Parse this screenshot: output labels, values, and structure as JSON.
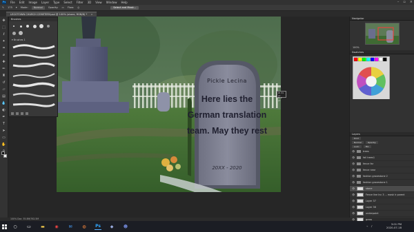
{
  "menubar": {
    "items": [
      "File",
      "Edit",
      "Image",
      "Layer",
      "Type",
      "Select",
      "Filter",
      "3D",
      "View",
      "Window",
      "Help"
    ]
  },
  "options": {
    "brush_size": "175",
    "mode_label": "Mode:",
    "mode_value": "Normal",
    "opacity_label": "Opacity:",
    "flow_label": "Flow:",
    "select_mask": "Select and Mask..."
  },
  "document": {
    "tab_title": "LEGOTOWN CHURCH CEMETERY.psd @ 100% (stone, RGB/8) *"
  },
  "brushes": {
    "title": "Brushes",
    "folder_label": "Brushes 1"
  },
  "canvas": {
    "stone_title": "Pickle Lecina",
    "stone_lines": [
      "Here lies the",
      "German translation",
      "team. May they rest"
    ],
    "stone_years": "20XX - 2020"
  },
  "readout": {
    "w": "W: 31 px",
    "h": "H: 2 px"
  },
  "panels": {
    "navigator": "Navigator",
    "zoom": "100%",
    "swatches": "Swatches",
    "layers": "Layers",
    "kind": "Kind",
    "blend": "Normal",
    "opacity": "Opacity:",
    "lock": "Lock:",
    "fill": "Fill:"
  },
  "layers": [
    {
      "name": "trees",
      "type": "folder",
      "visible": true,
      "selected": false
    },
    {
      "name": "fall trees1",
      "type": "folder",
      "visible": true,
      "selected": false
    },
    {
      "name": "fence far",
      "type": "folder",
      "visible": true,
      "selected": false
    },
    {
      "name": "fence near",
      "type": "folder",
      "visible": true,
      "selected": false
    },
    {
      "name": "fashion gravestone 2",
      "type": "folder",
      "visible": true,
      "selected": false
    },
    {
      "name": "fashion gravestone 1",
      "type": "folder",
      "visible": true,
      "selected": false
    },
    {
      "name": "stone",
      "type": "layer",
      "visible": true,
      "selected": true
    },
    {
      "name": "Fence line Inc 3 ... mask ir parent",
      "type": "layer",
      "visible": true,
      "selected": false
    },
    {
      "name": "Layer 37",
      "type": "layer",
      "visible": true,
      "selected": false
    },
    {
      "name": "Layer 36",
      "type": "layer",
      "visible": true,
      "selected": false
    },
    {
      "name": "underpaint",
      "type": "layer",
      "visible": true,
      "selected": false
    },
    {
      "name": "grass",
      "type": "layer",
      "visible": true,
      "selected": false
    }
  ],
  "status": {
    "text": "100%    Doc: 35.8M/762.5M"
  },
  "taskbar": {
    "time": "3:01 PM",
    "date": "2020-07-18"
  },
  "colors": {
    "accent": "#31a8ff",
    "stone": "#7d7f90",
    "grass": "#3f6a33"
  }
}
